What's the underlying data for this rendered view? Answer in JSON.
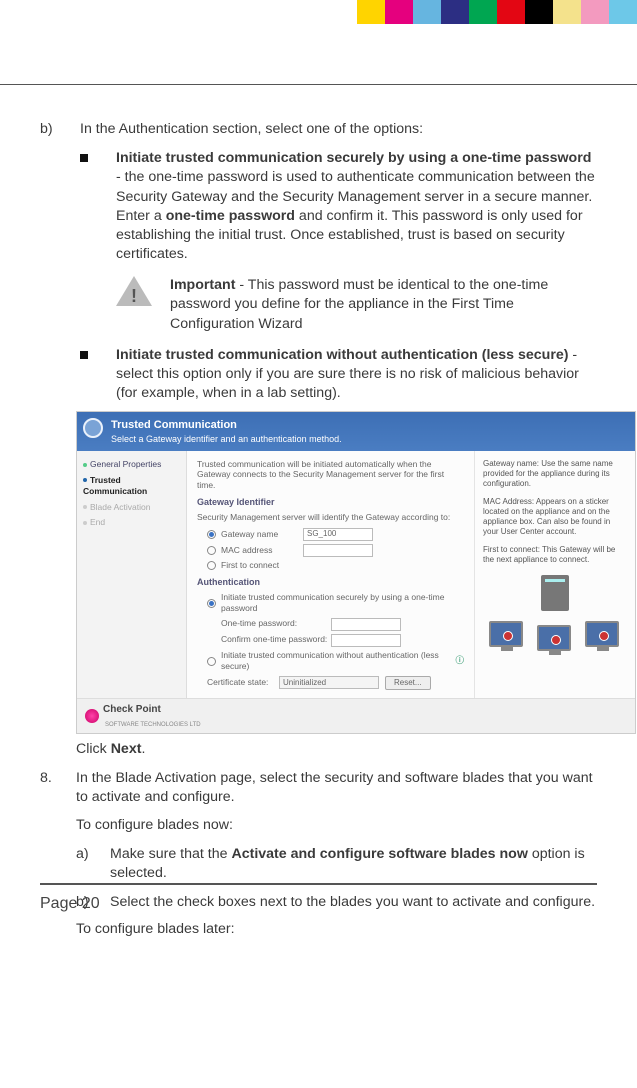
{
  "color_strip": [
    "#FFD400",
    "#E5007E",
    "#66B5E0",
    "#2C2E83",
    "#00A651",
    "#E30613",
    "#000000",
    "#F4E28C",
    "#F39ABF",
    "#6DC8E8"
  ],
  "step_b": {
    "label": "b)",
    "text": "In the Authentication section, select one of the options:"
  },
  "bullet1": {
    "title": "Initiate trusted communication securely by using a one-time password",
    "body1": " - the one-time password is used to authenticate communication between the Security Gateway and the Security Management server in a secure manner.",
    "body2a": "Enter a ",
    "body2b": "one-time password",
    "body2c": " and confirm it. This password is only used for establishing the initial trust. Once established, trust is based on security certificates."
  },
  "important": {
    "label": "Important",
    "text": " - This password must be identical to the one-time password you define for the appliance in the First Time Configuration Wizard"
  },
  "bullet2": {
    "title": "Initiate trusted communication without authentication (less secure)",
    "body": " - select this option only if you are sure there is no risk of malicious behavior (for example, when in a lab setting)."
  },
  "shot": {
    "header_title": "Trusted Communication",
    "header_sub": "Select a Gateway identifier and an authentication method.",
    "nav": {
      "item1": "General Properties",
      "item2": "Trusted Communication",
      "item3": "Blade Activation",
      "item4": "End"
    },
    "main_intro": "Trusted communication will be initiated automatically when the Gateway connects to the Security Management server for the first time.",
    "section1": "Gateway Identifier",
    "section1_sub": "Security Management server will identify the Gateway according to:",
    "radio_gateway_name": "Gateway name",
    "gateway_name_value": "SG_100",
    "radio_mac": "MAC address",
    "radio_first": "First to connect",
    "section2": "Authentication",
    "radio_secure": "Initiate trusted communication securely by using a one-time password",
    "otp_label": "One-time password:",
    "confirm_label": "Confirm one-time password:",
    "radio_insecure": "Initiate trusted communication without authentication (less secure)",
    "cert_label": "Certificate state:",
    "cert_value": "Uninitialized",
    "reset_btn": "Reset...",
    "side_p1": "Gateway name: Use the same name provided for the appliance during its configuration.",
    "side_p2": "MAC Address: Appears on a sticker located on the appliance and on the appliance box. Can also be found in your User Center account.",
    "side_p3": "First to connect: This Gateway will be the next appliance to connect.",
    "footer_brand": "Check Point",
    "footer_sub": "SOFTWARE TECHNOLOGIES LTD"
  },
  "click_next_a": "Click ",
  "click_next_b": "Next",
  "click_next_c": ".",
  "step8": {
    "num": "8.",
    "text": "In the Blade Activation page, select the security and software blades that you want to activate and configure.",
    "sub1": "To configure blades now:",
    "a_label": "a)",
    "a_text_a": "Make sure that the ",
    "a_text_b": "Activate and configure software blades now",
    "a_text_c": " option is selected.",
    "b_label": "b)",
    "b_text": "Select the check boxes next to the blades you want to activate and configure.",
    "sub2": "To configure blades later:"
  },
  "page_number": "Page 20"
}
